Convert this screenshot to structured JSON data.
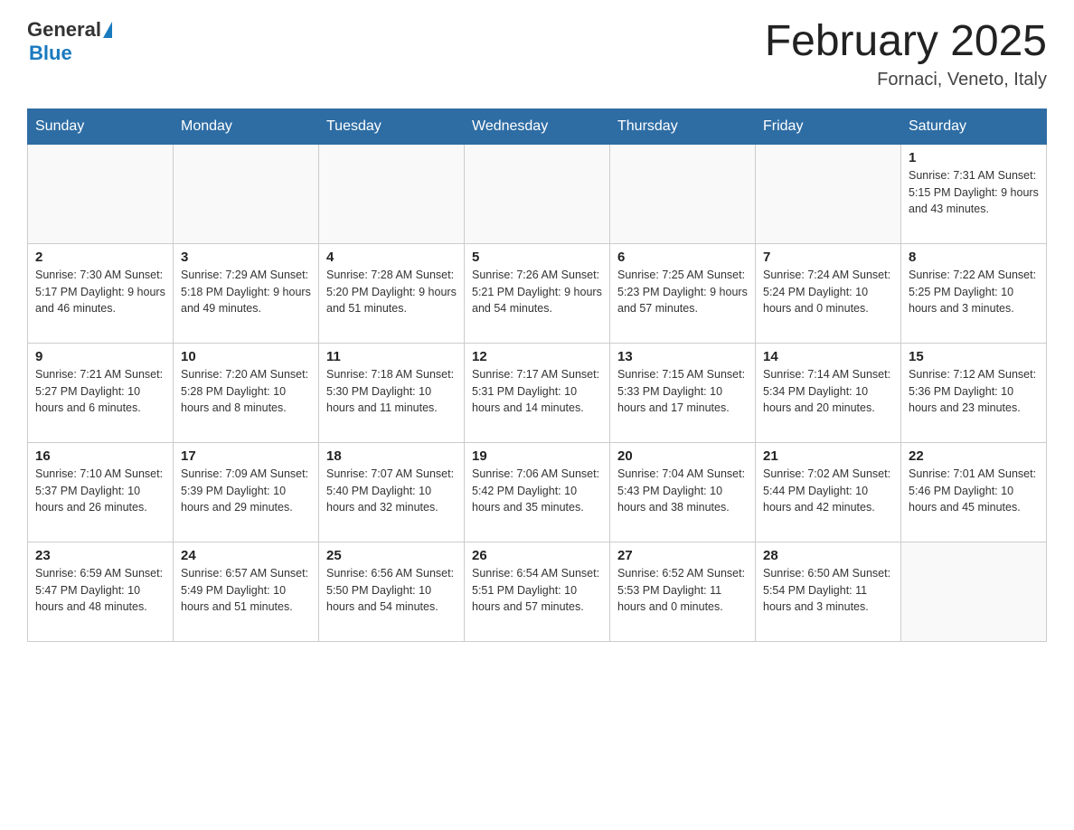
{
  "header": {
    "logo_general": "General",
    "logo_triangle": "▶",
    "logo_blue": "Blue",
    "month_title": "February 2025",
    "location": "Fornaci, Veneto, Italy"
  },
  "days_of_week": [
    "Sunday",
    "Monday",
    "Tuesday",
    "Wednesday",
    "Thursday",
    "Friday",
    "Saturday"
  ],
  "weeks": [
    [
      {
        "day": "",
        "info": ""
      },
      {
        "day": "",
        "info": ""
      },
      {
        "day": "",
        "info": ""
      },
      {
        "day": "",
        "info": ""
      },
      {
        "day": "",
        "info": ""
      },
      {
        "day": "",
        "info": ""
      },
      {
        "day": "1",
        "info": "Sunrise: 7:31 AM\nSunset: 5:15 PM\nDaylight: 9 hours\nand 43 minutes."
      }
    ],
    [
      {
        "day": "2",
        "info": "Sunrise: 7:30 AM\nSunset: 5:17 PM\nDaylight: 9 hours\nand 46 minutes."
      },
      {
        "day": "3",
        "info": "Sunrise: 7:29 AM\nSunset: 5:18 PM\nDaylight: 9 hours\nand 49 minutes."
      },
      {
        "day": "4",
        "info": "Sunrise: 7:28 AM\nSunset: 5:20 PM\nDaylight: 9 hours\nand 51 minutes."
      },
      {
        "day": "5",
        "info": "Sunrise: 7:26 AM\nSunset: 5:21 PM\nDaylight: 9 hours\nand 54 minutes."
      },
      {
        "day": "6",
        "info": "Sunrise: 7:25 AM\nSunset: 5:23 PM\nDaylight: 9 hours\nand 57 minutes."
      },
      {
        "day": "7",
        "info": "Sunrise: 7:24 AM\nSunset: 5:24 PM\nDaylight: 10 hours\nand 0 minutes."
      },
      {
        "day": "8",
        "info": "Sunrise: 7:22 AM\nSunset: 5:25 PM\nDaylight: 10 hours\nand 3 minutes."
      }
    ],
    [
      {
        "day": "9",
        "info": "Sunrise: 7:21 AM\nSunset: 5:27 PM\nDaylight: 10 hours\nand 6 minutes."
      },
      {
        "day": "10",
        "info": "Sunrise: 7:20 AM\nSunset: 5:28 PM\nDaylight: 10 hours\nand 8 minutes."
      },
      {
        "day": "11",
        "info": "Sunrise: 7:18 AM\nSunset: 5:30 PM\nDaylight: 10 hours\nand 11 minutes."
      },
      {
        "day": "12",
        "info": "Sunrise: 7:17 AM\nSunset: 5:31 PM\nDaylight: 10 hours\nand 14 minutes."
      },
      {
        "day": "13",
        "info": "Sunrise: 7:15 AM\nSunset: 5:33 PM\nDaylight: 10 hours\nand 17 minutes."
      },
      {
        "day": "14",
        "info": "Sunrise: 7:14 AM\nSunset: 5:34 PM\nDaylight: 10 hours\nand 20 minutes."
      },
      {
        "day": "15",
        "info": "Sunrise: 7:12 AM\nSunset: 5:36 PM\nDaylight: 10 hours\nand 23 minutes."
      }
    ],
    [
      {
        "day": "16",
        "info": "Sunrise: 7:10 AM\nSunset: 5:37 PM\nDaylight: 10 hours\nand 26 minutes."
      },
      {
        "day": "17",
        "info": "Sunrise: 7:09 AM\nSunset: 5:39 PM\nDaylight: 10 hours\nand 29 minutes."
      },
      {
        "day": "18",
        "info": "Sunrise: 7:07 AM\nSunset: 5:40 PM\nDaylight: 10 hours\nand 32 minutes."
      },
      {
        "day": "19",
        "info": "Sunrise: 7:06 AM\nSunset: 5:42 PM\nDaylight: 10 hours\nand 35 minutes."
      },
      {
        "day": "20",
        "info": "Sunrise: 7:04 AM\nSunset: 5:43 PM\nDaylight: 10 hours\nand 38 minutes."
      },
      {
        "day": "21",
        "info": "Sunrise: 7:02 AM\nSunset: 5:44 PM\nDaylight: 10 hours\nand 42 minutes."
      },
      {
        "day": "22",
        "info": "Sunrise: 7:01 AM\nSunset: 5:46 PM\nDaylight: 10 hours\nand 45 minutes."
      }
    ],
    [
      {
        "day": "23",
        "info": "Sunrise: 6:59 AM\nSunset: 5:47 PM\nDaylight: 10 hours\nand 48 minutes."
      },
      {
        "day": "24",
        "info": "Sunrise: 6:57 AM\nSunset: 5:49 PM\nDaylight: 10 hours\nand 51 minutes."
      },
      {
        "day": "25",
        "info": "Sunrise: 6:56 AM\nSunset: 5:50 PM\nDaylight: 10 hours\nand 54 minutes."
      },
      {
        "day": "26",
        "info": "Sunrise: 6:54 AM\nSunset: 5:51 PM\nDaylight: 10 hours\nand 57 minutes."
      },
      {
        "day": "27",
        "info": "Sunrise: 6:52 AM\nSunset: 5:53 PM\nDaylight: 11 hours\nand 0 minutes."
      },
      {
        "day": "28",
        "info": "Sunrise: 6:50 AM\nSunset: 5:54 PM\nDaylight: 11 hours\nand 3 minutes."
      },
      {
        "day": "",
        "info": ""
      }
    ]
  ]
}
